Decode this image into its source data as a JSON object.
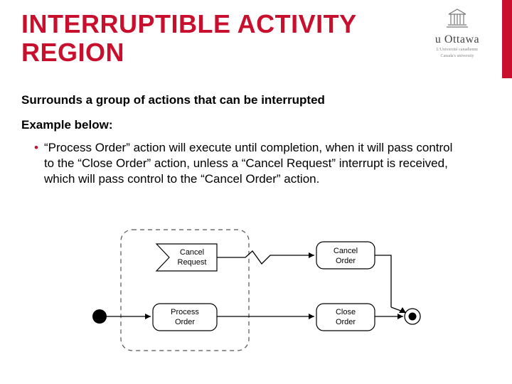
{
  "title": "INTERRUPTIBLE ACTIVITY REGION",
  "logo": {
    "wordmark": "u Ottawa",
    "tagline1": "L'Université canadienne",
    "tagline2": "Canada's university"
  },
  "body": {
    "p1": "Surrounds a group of actions that can be interrupted",
    "p2": "Example below:",
    "bullet": "“Process Order” action will execute until completion, when it will pass control to the “Close Order” action, unless a “Cancel Request” interrupt is received, which will pass control to the “Cancel Order” action."
  },
  "diagram": {
    "cancel_request": "Cancel\nRequest",
    "process_order": "Process\nOrder",
    "cancel_order": "Cancel\nOrder",
    "close_order": "Close\nOrder"
  }
}
